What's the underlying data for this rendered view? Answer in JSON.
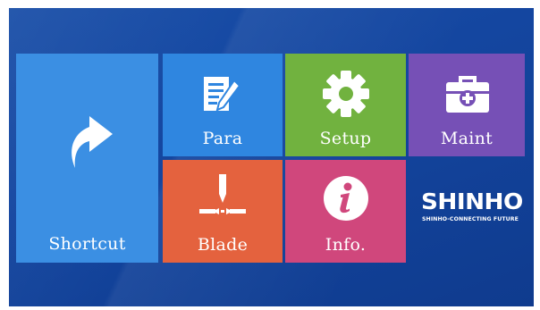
{
  "tiles": {
    "shortcut": {
      "label": "Shortcut",
      "icon": "shortcut-arrow-icon",
      "color": "#3b8fe3"
    },
    "para": {
      "label": "Para",
      "icon": "edit-document-icon",
      "color": "#2f86e0"
    },
    "setup": {
      "label": "Setup",
      "icon": "gear-icon",
      "color": "#71b23f"
    },
    "maint": {
      "label": "Maint",
      "icon": "toolbox-icon",
      "color": "#7650b6"
    },
    "blade": {
      "label": "Blade",
      "icon": "blade-cleave-icon",
      "color": "#e4623e"
    },
    "info": {
      "label": "Info.",
      "icon": "info-icon",
      "color": "#d0477c"
    }
  },
  "logo": {
    "wordmark": "SHINHO",
    "tagline": "SHINHO-CONNECTING FUTURE"
  },
  "background_color": "#1446a0"
}
